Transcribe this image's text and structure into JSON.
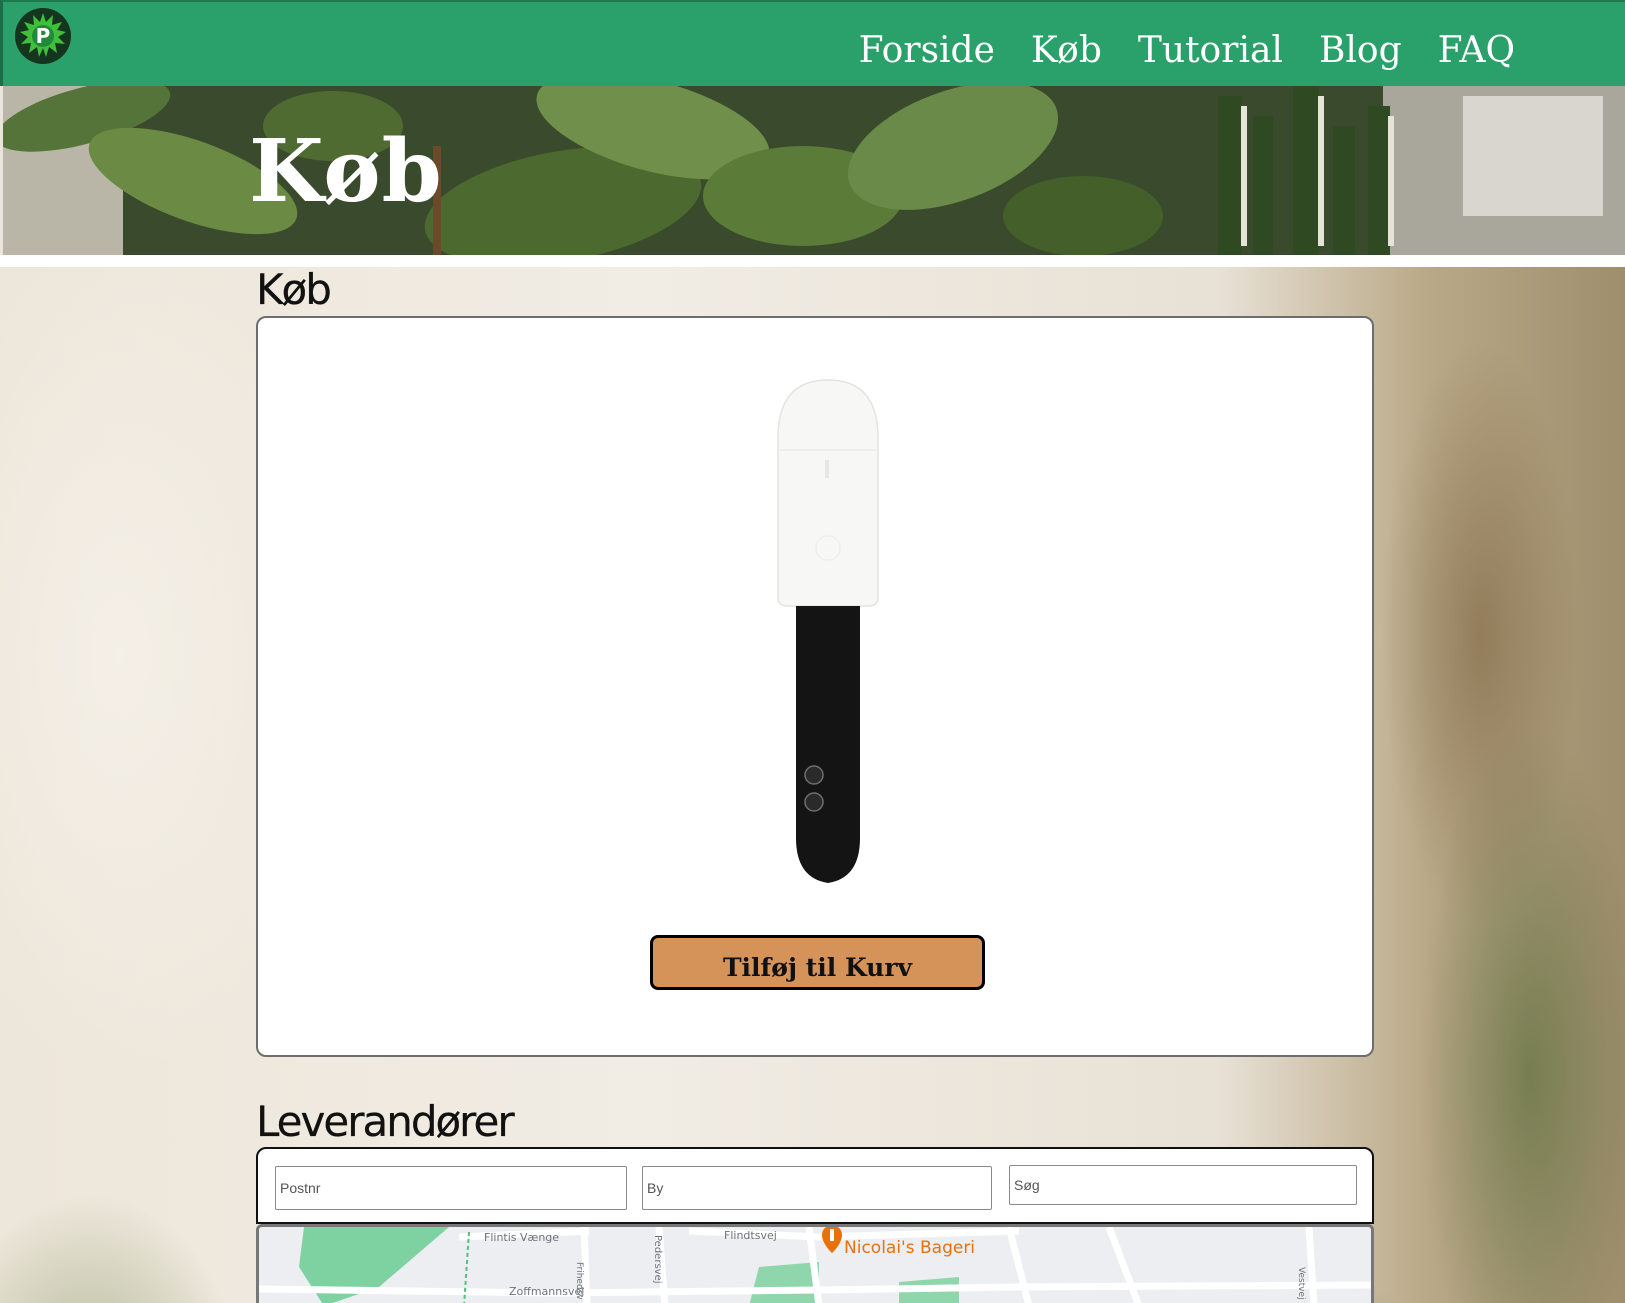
{
  "header": {
    "logo_letter": "P",
    "nav": [
      "Forside",
      "Køb",
      "Tutorial",
      "Blog",
      "FAQ"
    ]
  },
  "hero": {
    "title": "Køb"
  },
  "purchase": {
    "heading": "Køb",
    "product_image": "soil-sensor",
    "add_to_cart_label": "Tilføj til Kurv",
    "button_color": "#d69359"
  },
  "suppliers": {
    "heading": "Leverandører",
    "postnr_placeholder": "Postnr",
    "by_placeholder": "By",
    "search_placeholder": "Søg"
  },
  "map": {
    "place_label": "Nicolai's Bageri",
    "streets": [
      "Flintis Vænge",
      "Frihedsv",
      "Pedersvej",
      "Flindtsvej",
      "Zoffmannsvej",
      "Vestvej"
    ]
  },
  "colors": {
    "header_green": "#2aa06b",
    "accent_orange": "#d69359",
    "map_pin": "#e8710a"
  }
}
